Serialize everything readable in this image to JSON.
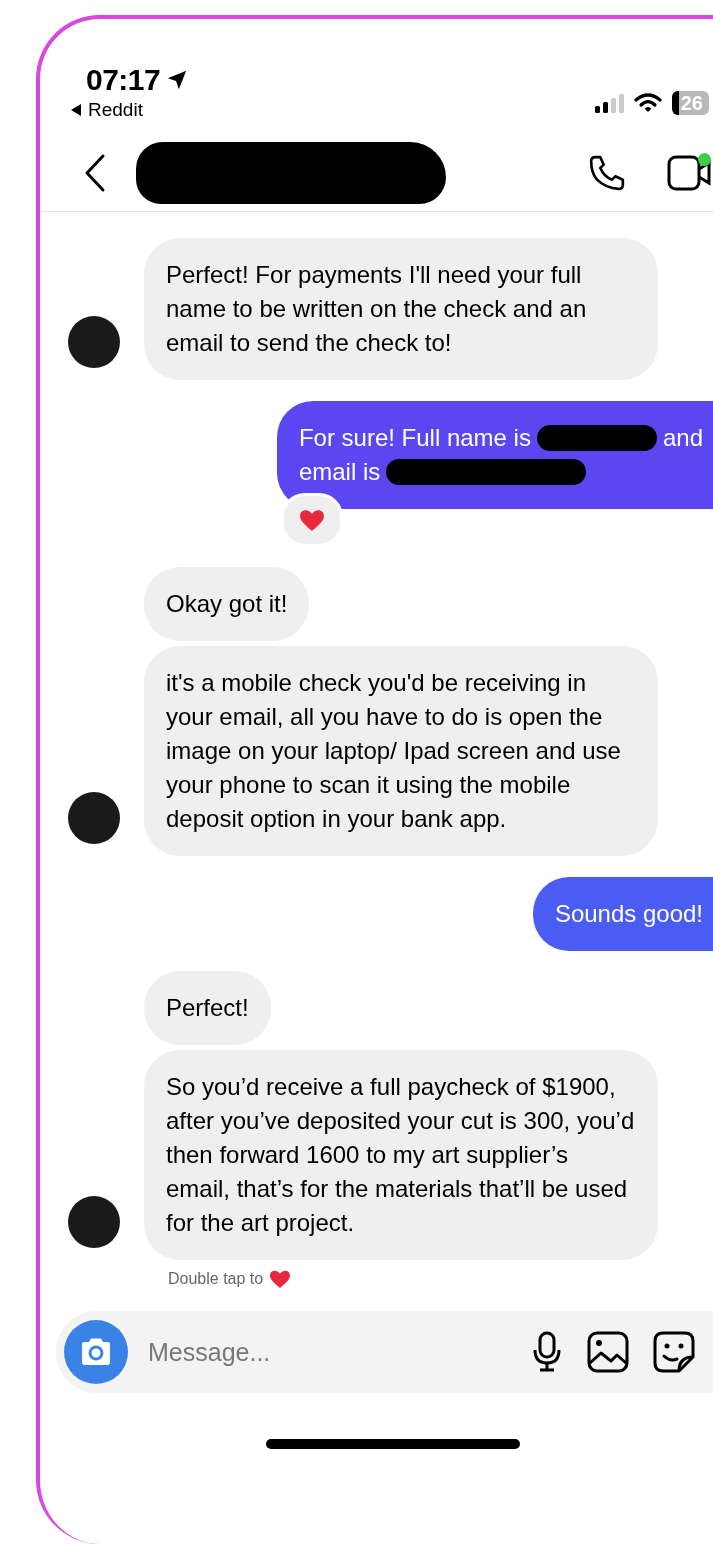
{
  "status_bar": {
    "time": "07:17",
    "back_app": "Reddit",
    "battery": "26"
  },
  "header": {
    "name_redacted": true,
    "online": true
  },
  "messages": [
    {
      "kind": "received",
      "avatar": true,
      "lines": [
        [
          {
            "kind": "text",
            "text": "Perfect! For payments I'll need your full name to be written on the check and an email to send the check to!"
          }
        ]
      ]
    },
    {
      "kind": "sent",
      "color": "#5b47f2",
      "reaction": true,
      "lines": [
        [
          {
            "kind": "text",
            "text": "For sure! Full name is"
          },
          {
            "kind": "redacted"
          },
          {
            "kind": "text",
            "text": "and"
          }
        ],
        [
          {
            "kind": "text",
            "text": "email is"
          },
          {
            "kind": "redacted"
          }
        ]
      ]
    },
    {
      "kind": "received",
      "avatar": false,
      "lines": [
        [
          {
            "kind": "text",
            "text": "Okay got it!"
          }
        ]
      ]
    },
    {
      "kind": "received",
      "avatar": true,
      "lines": [
        [
          {
            "kind": "text",
            "text": "it's a mobile check you'd be receiving in your email, all you have to do is open the image on your laptop/ Ipad screen and use your phone to scan it using the mobile deposit option in your bank app."
          }
        ]
      ]
    },
    {
      "kind": "sent",
      "color": "#4b5cf2",
      "reaction": false,
      "lines": [
        [
          {
            "kind": "text",
            "text": "Sounds good!"
          }
        ]
      ]
    },
    {
      "kind": "received",
      "avatar": false,
      "lines": [
        [
          {
            "kind": "text",
            "text": "Perfect!"
          }
        ]
      ]
    },
    {
      "kind": "received",
      "avatar": true,
      "lines": [
        [
          {
            "kind": "text",
            "text": "So you’d receive a full paycheck of $1900, after you’ve deposited your cut is 300, you’d then forward 1600 to my art supplier’s email, that’s for the materials that’ll be used for the art project."
          }
        ]
      ]
    }
  ],
  "hint": "Double tap to",
  "composer": {
    "placeholder": "Message..."
  }
}
